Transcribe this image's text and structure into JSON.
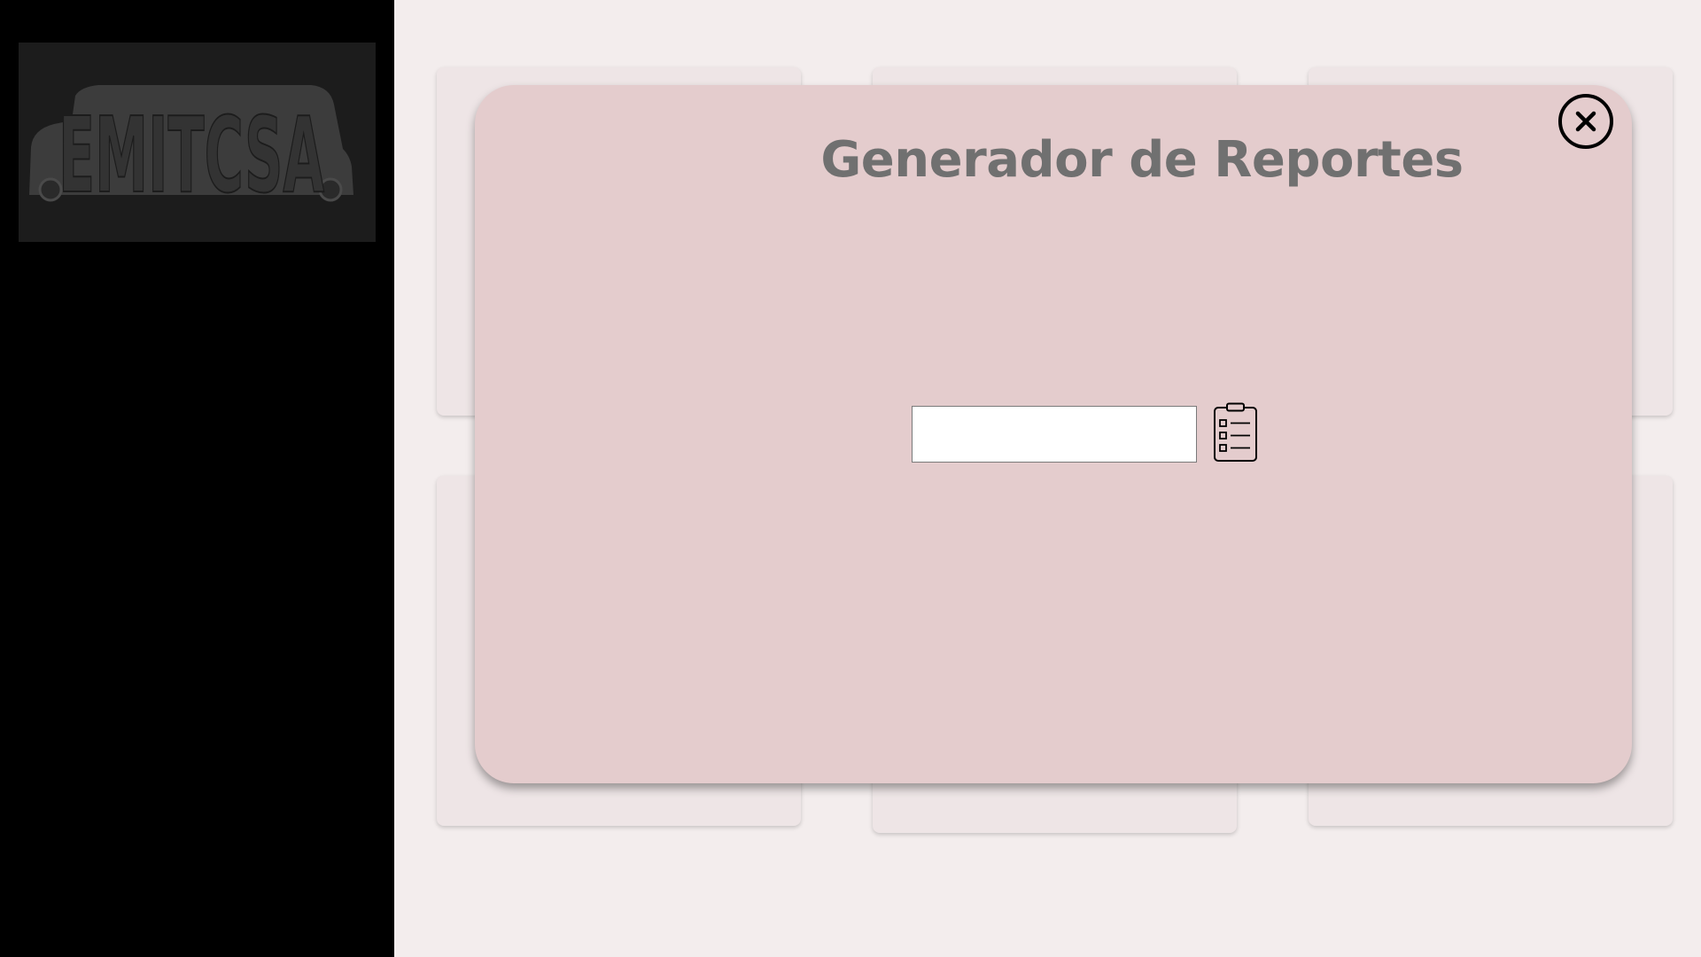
{
  "sidebar": {
    "logo": {
      "name": "emitcsa-logo",
      "text": "EMITCSA",
      "icon": "van-icon"
    }
  },
  "dashboard": {
    "cards": [
      "",
      "",
      "",
      "",
      "",
      ""
    ]
  },
  "modal": {
    "title": "Generador de Reportes",
    "close_icon": "close-icon",
    "report_input": {
      "value": "",
      "placeholder": ""
    },
    "generate_icon": "clipboard-list-icon"
  },
  "colors": {
    "sidebar_bg": "#000000",
    "page_bg": "#f3eded",
    "card_bg": "#eee5e6",
    "modal_bg": "#e4cccd",
    "title_color": "#707070"
  }
}
